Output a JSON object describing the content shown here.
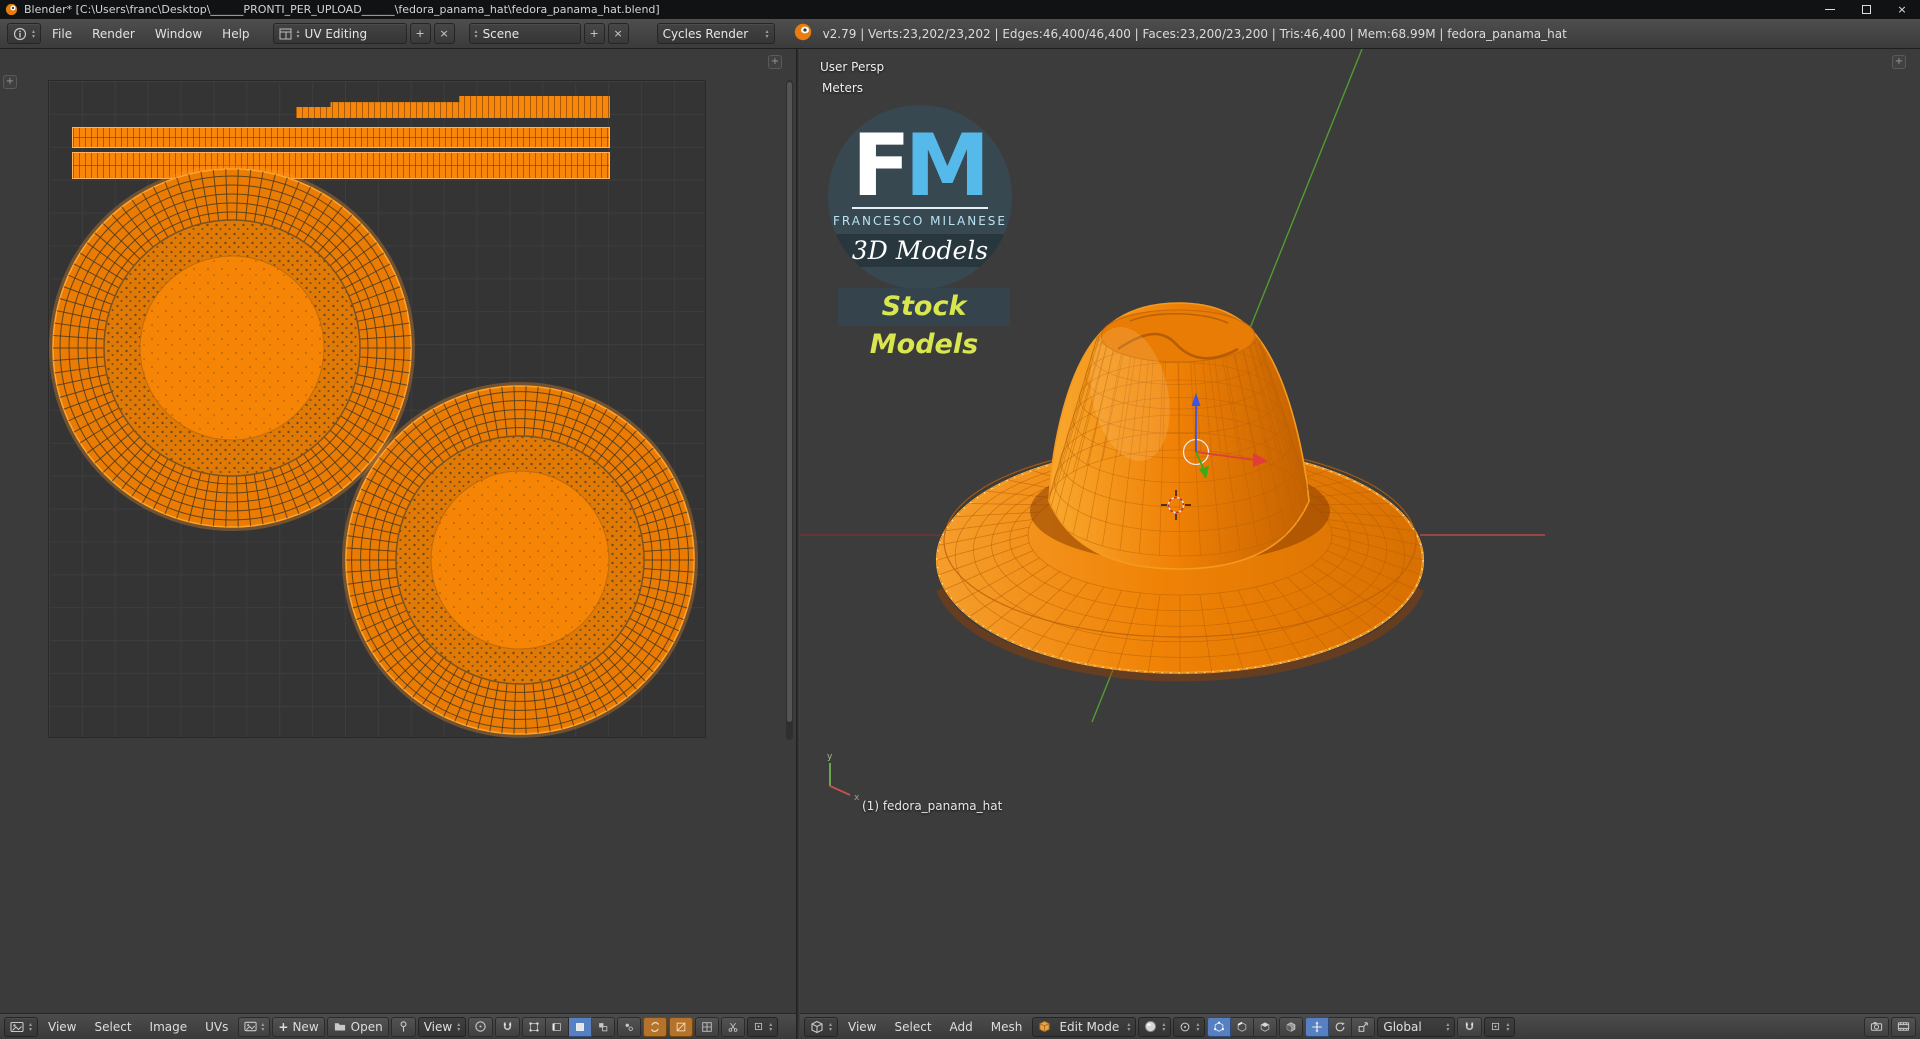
{
  "window": {
    "title": "Blender* [C:\\Users\\franc\\Desktop\\______PRONTI_PER_UPLOAD______\\fedora_panama_hat\\fedora_panama_hat.blend]",
    "controls": {
      "close": "×"
    }
  },
  "glyphs": {
    "plus": "+",
    "x": "×",
    "up": "▴",
    "down": "▾"
  },
  "topbar": {
    "menus": {
      "file": "File",
      "render": "Render",
      "window": "Window",
      "help": "Help"
    },
    "layout": {
      "value": "UV Editing"
    },
    "scene": {
      "value": "Scene"
    },
    "engine": {
      "value": "Cycles Render"
    },
    "stats": "v2.79 | Verts:23,202/23,202 | Edges:46,400/46,400 | Faces:23,200/23,200 | Tris:46,400 | Mem:68.99M | fedora_panama_hat"
  },
  "uv_editor": {
    "toolbar": {
      "view": "View",
      "select": "Select",
      "image": "Image",
      "uvs": "UVs",
      "new_label": "New",
      "open_label": "Open",
      "pivot_label": "View"
    }
  },
  "viewport": {
    "overlay": {
      "persp": "User Persp",
      "units": "Meters",
      "object_info": "(1) fedora_panama_hat"
    },
    "logo": {
      "f": "F",
      "m": "M",
      "name": "FRANCESCO MILANESE",
      "models": "3D Models",
      "badge": "Stock Models"
    },
    "toolbar": {
      "view": "View",
      "select": "Select",
      "add": "Add",
      "mesh": "Mesh",
      "mode": "Edit Mode",
      "orientation": "Global"
    },
    "axis_labels": {
      "x": "x",
      "y": "y"
    }
  },
  "colors": {
    "selection_orange": "#ff8c00",
    "wire_orange": "#b45f04",
    "axis_green": "#55a630",
    "axis_red": "#b94a4a",
    "logo_blue": "#55b9ea",
    "badge_yellow": "#d9e64d",
    "toggle_blue": "#5680c2"
  }
}
